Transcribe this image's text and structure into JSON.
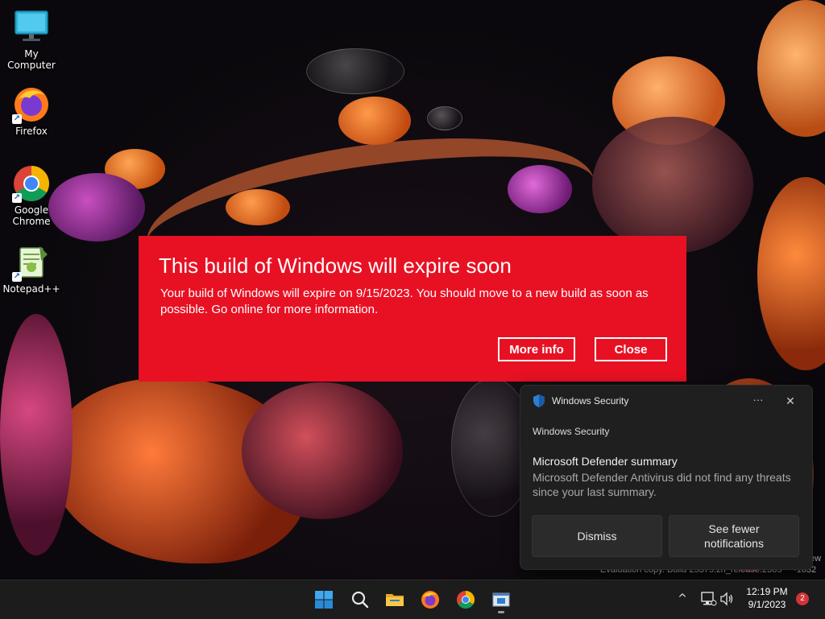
{
  "desktop": {
    "icons": [
      {
        "label": "My Computer",
        "icon": "monitor-icon"
      },
      {
        "label": "Firefox",
        "icon": "firefox-icon"
      },
      {
        "label": "Google Chrome",
        "icon": "chrome-icon"
      },
      {
        "label": "Notepad++",
        "icon": "notepadpp-icon"
      }
    ]
  },
  "expire_dialog": {
    "title": "This build of Windows will expire soon",
    "body": "Your build of Windows will expire on 9/15/2023. You should move to a new build as soon as possible. Go online for more information.",
    "more_info_label": "More info",
    "close_label": "Close",
    "background_color": "#e81123"
  },
  "toast": {
    "app_name": "Windows Security",
    "more_label": "···",
    "close_label": "✕",
    "attribution": "Windows Security",
    "heading": "Microsoft Defender summary",
    "message": "Microsoft Defender Antivirus did not find any threats since your last summary.",
    "dismiss_label": "Dismiss",
    "fewer_label": "See fewer notifications"
  },
  "watermark": {
    "line1_fragment": "ew",
    "line2_fragment": "Evaluation copy. Build 25375.zn_release.2305",
    "line2_tail": "-1632"
  },
  "taskbar": {
    "apps": [
      {
        "name": "start",
        "icon": "windows-logo-icon"
      },
      {
        "name": "search",
        "icon": "search-icon"
      },
      {
        "name": "file-explorer",
        "icon": "folder-icon"
      },
      {
        "name": "firefox",
        "icon": "firefox-icon"
      },
      {
        "name": "chrome",
        "icon": "chrome-icon"
      },
      {
        "name": "active-app",
        "icon": "app-window-icon"
      }
    ],
    "tray": {
      "chevron": "^",
      "time": "12:19 PM",
      "date": "9/1/2023",
      "notification_count": "2"
    }
  }
}
